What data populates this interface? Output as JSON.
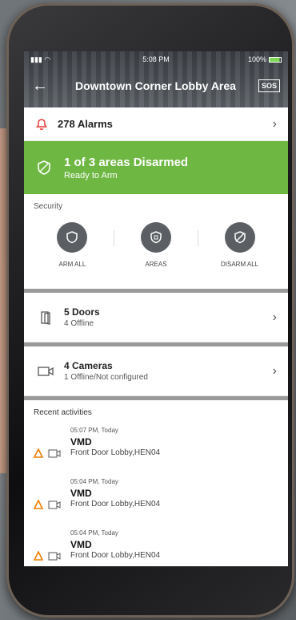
{
  "status": {
    "time": "5:08 PM",
    "battery": "100%"
  },
  "header": {
    "title": "Downtown Corner Lobby Area",
    "sos": "SOS"
  },
  "alarms": {
    "label": "278 Alarms"
  },
  "area_status": {
    "title": "1 of 3 areas Disarmed",
    "subtitle": "Ready to Arm",
    "color": "#6fb743"
  },
  "security": {
    "title": "Security",
    "buttons": [
      {
        "label": "ARM ALL",
        "icon": "shield-icon"
      },
      {
        "label": "AREAS",
        "icon": "areas-shield-icon"
      },
      {
        "label": "DISARM ALL",
        "icon": "shield-off-icon"
      }
    ]
  },
  "devices": [
    {
      "name": "5 Doors",
      "status": "4 Offline",
      "icon": "door-icon"
    },
    {
      "name": "4 Cameras",
      "status": "1 Offline/Not configured",
      "icon": "camera-icon"
    }
  ],
  "recent": {
    "title": "Recent activities",
    "items": [
      {
        "time": "05:07 PM, Today",
        "event": "VMD",
        "location": "Front Door Lobby,HEN04"
      },
      {
        "time": "05:04 PM, Today",
        "event": "VMD",
        "location": "Front Door Lobby,HEN04"
      },
      {
        "time": "05:04 PM, Today",
        "event": "VMD",
        "location": "Front Door Lobby,HEN04"
      }
    ]
  },
  "colors": {
    "alarm_red": "#e53935",
    "warning_orange": "#f07d00"
  }
}
